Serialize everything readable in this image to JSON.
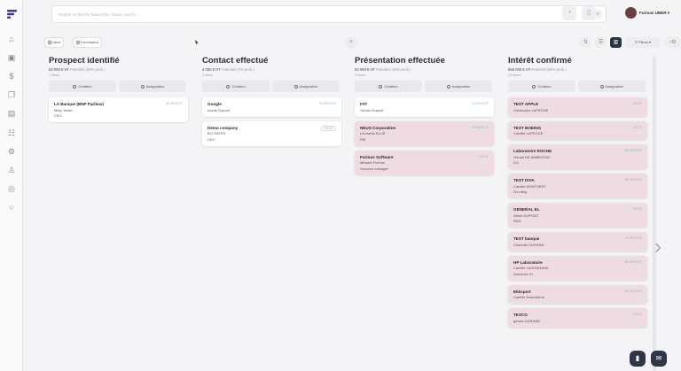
{
  "topbar": {
    "search_placeholder": "Rapide recherche fastest the classic search",
    "username": "Furious UBER",
    "btn1_icon": "search-icon",
    "btn2_icon": "grid-icon",
    "btn3_icon": "document-icon"
  },
  "toolbar": {
    "pill1": "client",
    "pill2": "Fournisseur",
    "filters": "Filtres"
  },
  "actions": {
    "creation": "Création",
    "assignation": "Assignation"
  },
  "columns": [
    {
      "title": "Prospect identifié",
      "amount": "83 000 € HT",
      "amount_sub": "Potentiel (30% prob.)",
      "count": "1 items",
      "cards": [
        {
          "name": "LA Banque (BNP Paribas)",
          "line1": "Mary Tester",
          "line2": "CEO",
          "amount": "26 000 € HT",
          "pink": false,
          "tag": false
        }
      ]
    },
    {
      "title": "Contact effectué",
      "amount": "2 000 € HT",
      "amount_sub": "Potentiel (0% prob.)",
      "count": "2 items",
      "cards": [
        {
          "name": "Google",
          "line1": "Axelle Dupont",
          "line2": "",
          "amount": "20 000 € HT",
          "pink": false,
          "tag": false
        },
        {
          "name": "Demo company",
          "line1": "BO GATES",
          "line2": "CEO",
          "amount": "0 € HT",
          "pink": false,
          "tag": true
        }
      ]
    },
    {
      "title": "Présentation effectuée",
      "amount": "53 000 € HT",
      "amount_sub": "Potentiel (40% prob.)",
      "count": "3 items",
      "cards": [
        {
          "name": "FAT",
          "line1": "Gérard Dupont",
          "line2": "",
          "amount": "10 000 € HT",
          "pink": false,
          "tag": false
        },
        {
          "name": "NEUS Corporation",
          "line1": "Léonardo BLUE",
          "line2": "PM",
          "amount": "20 000 € HT",
          "pink": true,
          "tag": false
        },
        {
          "name": "Furious Software",
          "line1": "Mickael Furious",
          "line2": "Success manager",
          "amount": "3 € HT",
          "pink": true,
          "tag": false
        }
      ]
    },
    {
      "title": "Intérêt confirmé",
      "amount": "556 000 € HT",
      "amount_sub": "Potentiel (60% prob.)",
      "count": "12 items",
      "cards": [
        {
          "name": "TEST APPLE",
          "line1": "Christophe LAPEGUE",
          "line2": "",
          "amount": "0 € HT",
          "pink": true,
          "tag": false
        },
        {
          "name": "TEST BOEING",
          "line1": "Camille LAPEGUE",
          "line2": "",
          "amount": "0 € HT",
          "pink": true,
          "tag": false
        },
        {
          "name": "Laboratoire ROCHE",
          "line1": "Gérald DE AMBROSIO",
          "line2": "DG",
          "amount": "50 000 € HT",
          "pink": true,
          "tag": false
        },
        {
          "name": "TEST DIVA",
          "line1": "Camille MONTVERT",
          "line2": "Dir mktg",
          "amount": "80 000 € HT",
          "pink": true,
          "tag": false
        },
        {
          "name": "GENERAL EL",
          "line1": "Albert DUPONT",
          "line2": "PDG",
          "amount": "0 € HT",
          "pink": true,
          "tag": false
        },
        {
          "name": "TEST banque",
          "line1": "Charlotte DURAND",
          "line2": "",
          "amount": "40 000 € HT",
          "pink": true,
          "tag": false
        },
        {
          "name": "HP Laboratoire",
          "line1": "Camille LAHONNAND",
          "line2": "Directrice SI",
          "amount": "30 000 € HT",
          "pink": true,
          "tag": false
        },
        {
          "name": "Ekksport",
          "line1": "Camille Desesterne",
          "line2": "",
          "amount": "60 000 € HT",
          "pink": true,
          "tag": false
        },
        {
          "name": "TESCO",
          "line1": "gérard DURAND",
          "line2": "",
          "amount": "0 € HT",
          "pink": true,
          "tag": false
        }
      ]
    }
  ]
}
